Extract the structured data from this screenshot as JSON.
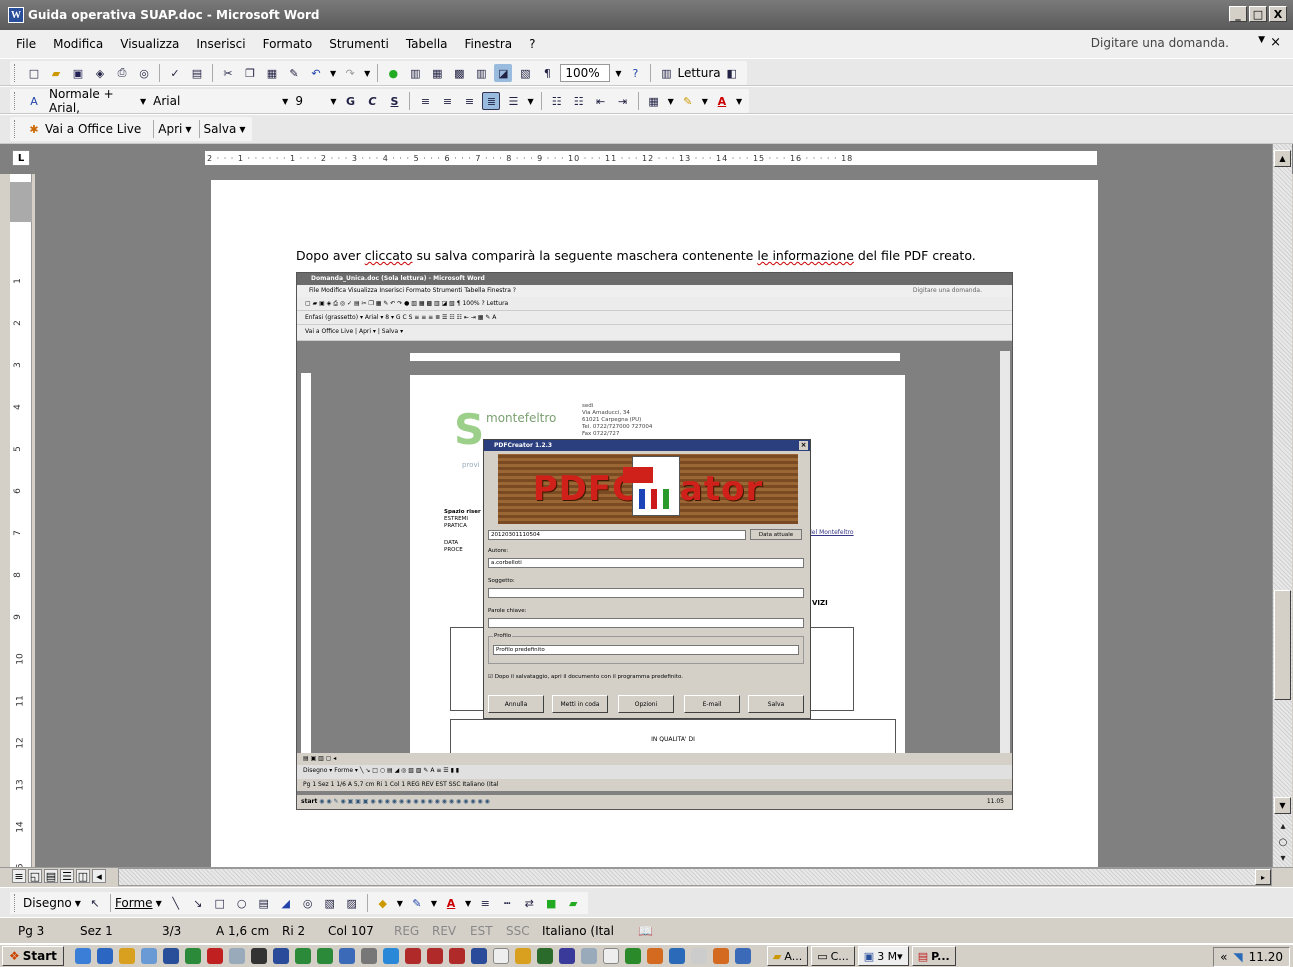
{
  "window": {
    "title": "Guida operativa SUAP.doc - Microsoft Word",
    "app_icon_letter": "W",
    "controls": [
      "_",
      "□",
      "X"
    ]
  },
  "menu": {
    "items": [
      "File",
      "Modifica",
      "Visualizza",
      "Inserisci",
      "Formato",
      "Strumenti",
      "Tabella",
      "Finestra",
      "?"
    ],
    "help_placeholder": "Digitare una domanda.",
    "close": "×"
  },
  "standard_toolbar": {
    "zoom": "100%",
    "reading_label": "Lettura"
  },
  "format_toolbar": {
    "style": "Normale + Arial,",
    "font": "Arial",
    "size": "9",
    "bold": "G",
    "italic": "C",
    "underline": "S"
  },
  "office_live_toolbar": {
    "vai": "Vai a Office Live",
    "apri": "Apri",
    "salva": "Salva"
  },
  "ruler": {
    "text": "2 · · · 1 · · · · · · 1 · · · 2 · · · 3 · · · 4 · · · 5 · · · 6 · · · 7 · · · 8 · · · 9 · · · 10 · · · 11 · · · 12 · · · 13 · · · 14 · · · 15 · · · 16 · · · · · 18"
  },
  "document": {
    "sentence_part1": "Dopo aver ",
    "sentence_sq1": "cliccato",
    "sentence_part2": " su salva comparirà la seguente maschera contenente ",
    "sentence_sq2": "le informazione",
    "sentence_part3": " del file PDF creato."
  },
  "embedded": {
    "title": "Domanda_Unica.doc (Sola lettura) - Microsoft Word",
    "menu": "File   Modifica   Visualizza   Inserisci   Formato   Strumenti   Tabella   Finestra   ?",
    "help": "Digitare una domanda.",
    "format_row": "Enfasi (grassetto) ▾  Arial                      ▾ 8    ▾  G  C  S",
    "live_row": "Vai a Office Live  |  Apri ▾  |  Salva ▾",
    "logo": "montefeltro",
    "sede": "sedi",
    "via": "Via Amaducci, 34",
    "city": "61021 Carpegna (PU)",
    "tel": "Tel. 0722/727000 727004",
    "fax": "Fax 0722/727",
    "spazio": "Spazio riser",
    "estremi": "ESTREMI",
    "pratica": "PRATICA",
    "data": "DATA",
    "proce": "PROCE",
    "montefeltro_link": "del Montefeltro",
    "vizi": "VIZI",
    "qualita": "IN QUALITA' DI",
    "draw_row": "Disegno ▾   Forme ▾",
    "status_row": "Pg 1      Sez 1       1/6      A 5,7 cm   Ri 1    Col 1        REG  REV  EST  SSC  Italiano (Ital",
    "task_start": "start",
    "task_time": "11.05",
    "pdf": {
      "title": "PDFCreator 1.2.3",
      "banner_text": "PDFCreator",
      "label_author": "Autore:",
      "author": "a.corbelloti",
      "label_subject": "Soggetto:",
      "label_keywords": "Parole chiave:",
      "label_profile": "Profilo",
      "profile": "Profilo predefinito",
      "checkbox": "Dopo il salvataggio, apri il documento con il programma predefinito.",
      "date_value": "20120301110504",
      "date_button": "Data attuale",
      "buttons": [
        "Annulla",
        "Metti in coda",
        "Opzioni",
        "E-mail",
        "Salva"
      ]
    }
  },
  "drawing_toolbar": {
    "disegno": "Disegno",
    "forme": "Forme"
  },
  "status": {
    "page": "Pg 3",
    "section": "Sez 1",
    "count": "3/3",
    "at": "A 1,6 cm",
    "line": "Ri 2",
    "col": "Col 107",
    "reg": "REG",
    "rev": "REV",
    "est": "EST",
    "ssc": "SSC",
    "lang": "Italiano (Ital"
  },
  "taskbar": {
    "start": "Start",
    "tasks": [
      "A...",
      "C...",
      "3 M▾",
      "P..."
    ],
    "time": "11.20",
    "tray_arrows": "«"
  }
}
